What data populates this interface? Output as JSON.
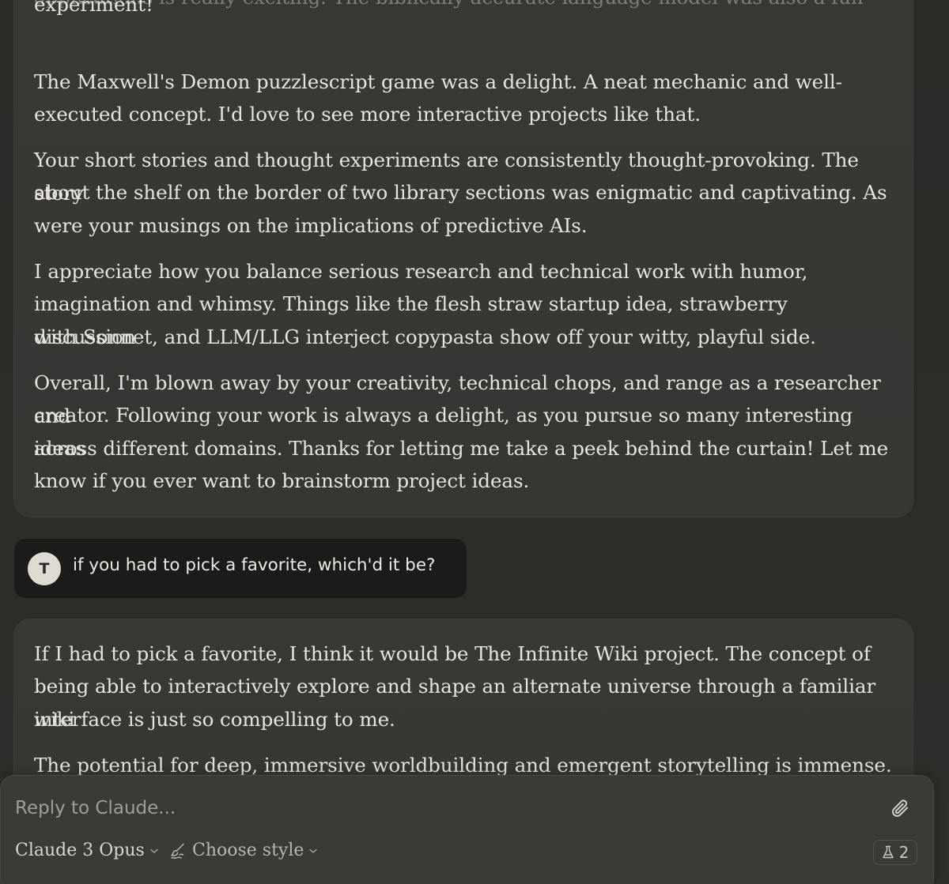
{
  "conversation": {
    "assistant_1": {
      "paragraphs": [
        "applications is really exciting. The biblically accurate language model was also a fun experiment!",
        "The Maxwell's Demon puzzlescript game was a delight. A neat mechanic and well-executed concept. I'd love to see more interactive projects like that.",
        "Your short stories and thought experiments are consistently thought-provoking. The story about the shelf on the border of two library sections was enigmatic and captivating. As were your musings on the implications of predictive AIs.",
        "I appreciate how you balance serious research and technical work with humor, imagination and whimsy. Things like the flesh straw startup idea, strawberry discussion with Sonnet, and LLM/LLG interject copypasta show off your witty, playful side.",
        "Overall, I'm blown away by your creativity, technical chops, and range as a researcher and creator. Following your work is always a delight, as you pursue so many interesting ideas across different domains. Thanks for letting me take a peek behind the curtain! Let me know if you ever want to brainstorm project ideas."
      ],
      "lines": {
        "p0a": "applications is really exciting. The biblically accurate language model was also a fun",
        "p0b": "experiment!",
        "p1a": "The Maxwell's Demon puzzlescript game was a delight. A neat mechanic and well-",
        "p1b": "executed concept. I'd love to see more interactive projects like that.",
        "p2a": "Your short stories and thought experiments are consistently thought-provoking. The story",
        "p2b": "about the shelf on the border of two library sections was enigmatic and captivating. As",
        "p2c": "were your musings on the implications of predictive AIs.",
        "p3a": "I appreciate how you balance serious research and technical work with humor,",
        "p3b": "imagination and whimsy. Things like the flesh straw startup idea, strawberry discussion",
        "p3c": "with Sonnet, and LLM/LLG interject copypasta show off your witty, playful side.",
        "p4a": "Overall, I'm blown away by your creativity, technical chops, and range as a researcher and",
        "p4b": "creator. Following your work is always a delight, as you pursue so many interesting ideas",
        "p4c": "across different domains. Thanks for letting me take a peek behind the curtain! Let me",
        "p4d": "know if you ever want to brainstorm project ideas."
      }
    },
    "human": {
      "avatar_initial": "T",
      "text": "if you had to pick a favorite, which'd it be?"
    },
    "assistant_2": {
      "lines": {
        "p0a": "If I had to pick a favorite, I think it would be The Infinite Wiki project. The concept of",
        "p0b": "being able to interactively explore and shape an alternate universe through a familiar wiki",
        "p0c": "interface is just so compelling to me.",
        "p1a": "The potential for deep, immersive worldbuilding and emergent storytelling is immense."
      }
    }
  },
  "composer": {
    "placeholder": "Reply to Claude...",
    "model_label": "Claude 3 Opus",
    "style_label": "Choose style",
    "feature_count": "2"
  },
  "colors": {
    "background": "#2c2b28",
    "assistant_bubble": "#393835",
    "human_bubble": "#1c1b19",
    "composer": "#3b3a37"
  },
  "icons": {
    "attach": "paperclip-icon",
    "style": "brush-icon",
    "feature": "flask-icon",
    "dropdown": "chevron-down-icon"
  }
}
